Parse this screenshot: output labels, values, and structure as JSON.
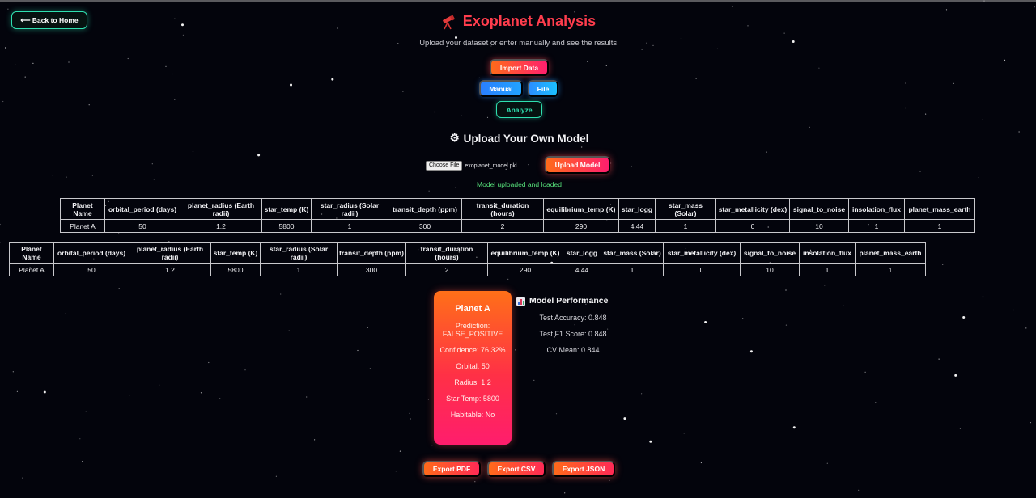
{
  "nav": {
    "back_label": "⟵ Back to Home"
  },
  "header": {
    "title": "Exoplanet Analysis",
    "title_icon": "telescope-icon",
    "subtitle": "Upload your dataset or enter manually and see the results!"
  },
  "controls": {
    "import_label": "Import Data",
    "manual_label": "Manual",
    "file_label": "File",
    "analyze_label": "Analyze"
  },
  "model_upload": {
    "heading": "Upload Your Own Model",
    "heading_icon": "gear-icon",
    "choose_label": "Choose File",
    "file_name": "exoplanet_model.pkl",
    "upload_label": "Upload Model",
    "status": "Model uploaded and loaded"
  },
  "table1": {
    "headers": [
      "Planet Name",
      "orbital_period (days)",
      "planet_radius (Earth radii)",
      "star_temp (K)",
      "star_radius (Solar radii)",
      "transit_depth (ppm)",
      "transit_duration (hours)",
      "equilibrium_temp (K)",
      "star_logg",
      "star_mass (Solar)",
      "star_metallicity (dex)",
      "signal_to_noise",
      "insolation_flux",
      "planet_mass_earth"
    ],
    "rows": [
      [
        "Planet A",
        "50",
        "1.2",
        "5800",
        "1",
        "300",
        "2",
        "290",
        "4.44",
        "1",
        "0",
        "10",
        "1",
        "1"
      ]
    ]
  },
  "table2": {
    "headers": [
      "Planet Name",
      "orbital_period (days)",
      "planet_radius (Earth radii)",
      "star_temp (K)",
      "star_radius (Solar radii)",
      "transit_depth (ppm)",
      "transit_duration (hours)",
      "equilibrium_temp (K)",
      "star_logg",
      "star_mass (Solar)",
      "star_metallicity (dex)",
      "signal_to_noise",
      "insolation_flux",
      "planet_mass_earth"
    ],
    "rows": [
      [
        "Planet A",
        "50",
        "1.2",
        "5800",
        "1",
        "300",
        "2",
        "290",
        "4.44",
        "1",
        "0",
        "10",
        "1",
        "1"
      ]
    ]
  },
  "result_card": {
    "title": "Planet A",
    "prediction": "Prediction: FALSE_POSITIVE",
    "confidence": "Confidence: 76.32%",
    "orbital": "Orbital: 50",
    "radius": "Radius: 1.2",
    "star_temp": "Star Temp: 5800",
    "habitable": "Habitable: No"
  },
  "performance": {
    "title": "Model Performance",
    "title_icon": "bar-chart-icon",
    "accuracy": "Test Accuracy: 0.848",
    "f1": "Test F1 Score: 0.848",
    "cv": "CV Mean: 0.844"
  },
  "export": {
    "pdf_label": "Export PDF",
    "csv_label": "Export CSV",
    "json_label": "Export JSON"
  },
  "colors": {
    "accent_red": "#ff3d4d",
    "accent_teal": "#2fe0b0",
    "success_green": "#56e07a",
    "background": "#03040c"
  }
}
